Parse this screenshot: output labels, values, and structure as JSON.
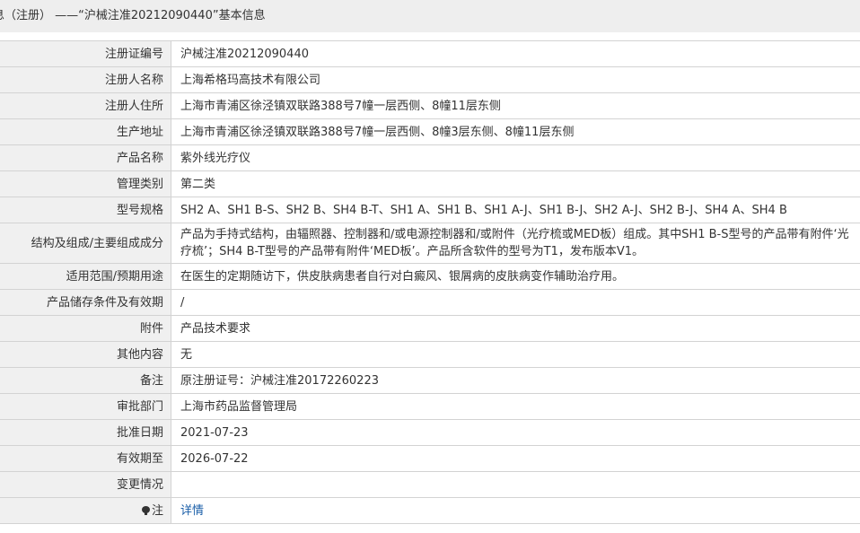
{
  "title": "息（注册） ——“沪械注准20212090440”基本信息",
  "rows": [
    {
      "label": "注册证编号",
      "value": "沪械注准20212090440"
    },
    {
      "label": "注册人名称",
      "value": "上海希格玛高技术有限公司"
    },
    {
      "label": "注册人住所",
      "value": "上海市青浦区徐泾镇双联路388号7幢一层西侧、8幢11层东侧"
    },
    {
      "label": "生产地址",
      "value": "上海市青浦区徐泾镇双联路388号7幢一层西侧、8幢3层东侧、8幢11层东侧"
    },
    {
      "label": "产品名称",
      "value": "紫外线光疗仪"
    },
    {
      "label": "管理类别",
      "value": "第二类"
    },
    {
      "label": "型号规格",
      "value": "SH2 A、SH1 B-S、SH2 B、SH4 B-T、SH1 A、SH1 B、SH1 A-J、SH1 B-J、SH2 A-J、SH2 B-J、SH4 A、SH4 B"
    },
    {
      "label": "结构及组成/主要组成成分",
      "value": "产品为手持式结构，由辐照器、控制器和/或电源控制器和/或附件（光疗梳或MED板）组成。其中SH1 B-S型号的产品带有附件‘光疗梳’；SH4 B-T型号的产品带有附件‘MED板’。产品所含软件的型号为T1，发布版本V1。"
    },
    {
      "label": "适用范围/预期用途",
      "value": "在医生的定期随访下，供皮肤病患者自行对白癜风、银屑病的皮肤病变作辅助治疗用。"
    },
    {
      "label": "产品储存条件及有效期",
      "value": "/"
    },
    {
      "label": "附件",
      "value": "产品技术要求"
    },
    {
      "label": "其他内容",
      "value": "无"
    },
    {
      "label": "备注",
      "value": "原注册证号：沪械注准20172260223"
    },
    {
      "label": "审批部门",
      "value": "上海市药品监督管理局"
    },
    {
      "label": "批准日期",
      "value": "2021-07-23"
    },
    {
      "label": "有效期至",
      "value": "2026-07-22"
    },
    {
      "label": "变更情况",
      "value": ""
    }
  ],
  "note": {
    "label": "注",
    "icon": "lightbulb-icon",
    "link_text": "详情"
  }
}
